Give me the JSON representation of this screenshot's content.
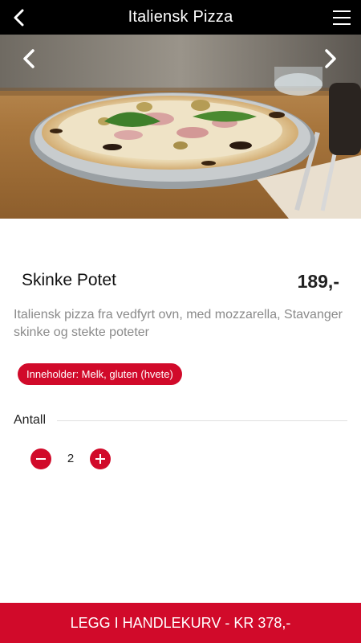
{
  "header": {
    "title": "Italiensk Pizza",
    "back_icon": "chevron-left-icon",
    "menu_icon": "hamburger-menu-icon"
  },
  "hero": {
    "prev_icon": "chevron-left-icon",
    "next_icon": "chevron-right-icon"
  },
  "product": {
    "name": "Skinke Potet",
    "price": "189,-",
    "description": "Italiensk pizza fra vedfyrt ovn, med mozzarella, Stavanger skinke og stekte poteter",
    "allergens": "Inneholder: Melk, gluten (hvete)"
  },
  "quantity": {
    "label": "Antall",
    "value": "2"
  },
  "cart": {
    "button_label": "LEGG I HANDLEKURV - KR 378,-"
  },
  "colors": {
    "accent": "#d10a2a",
    "header_bg": "#000000",
    "description_text": "#8a8a8a"
  }
}
